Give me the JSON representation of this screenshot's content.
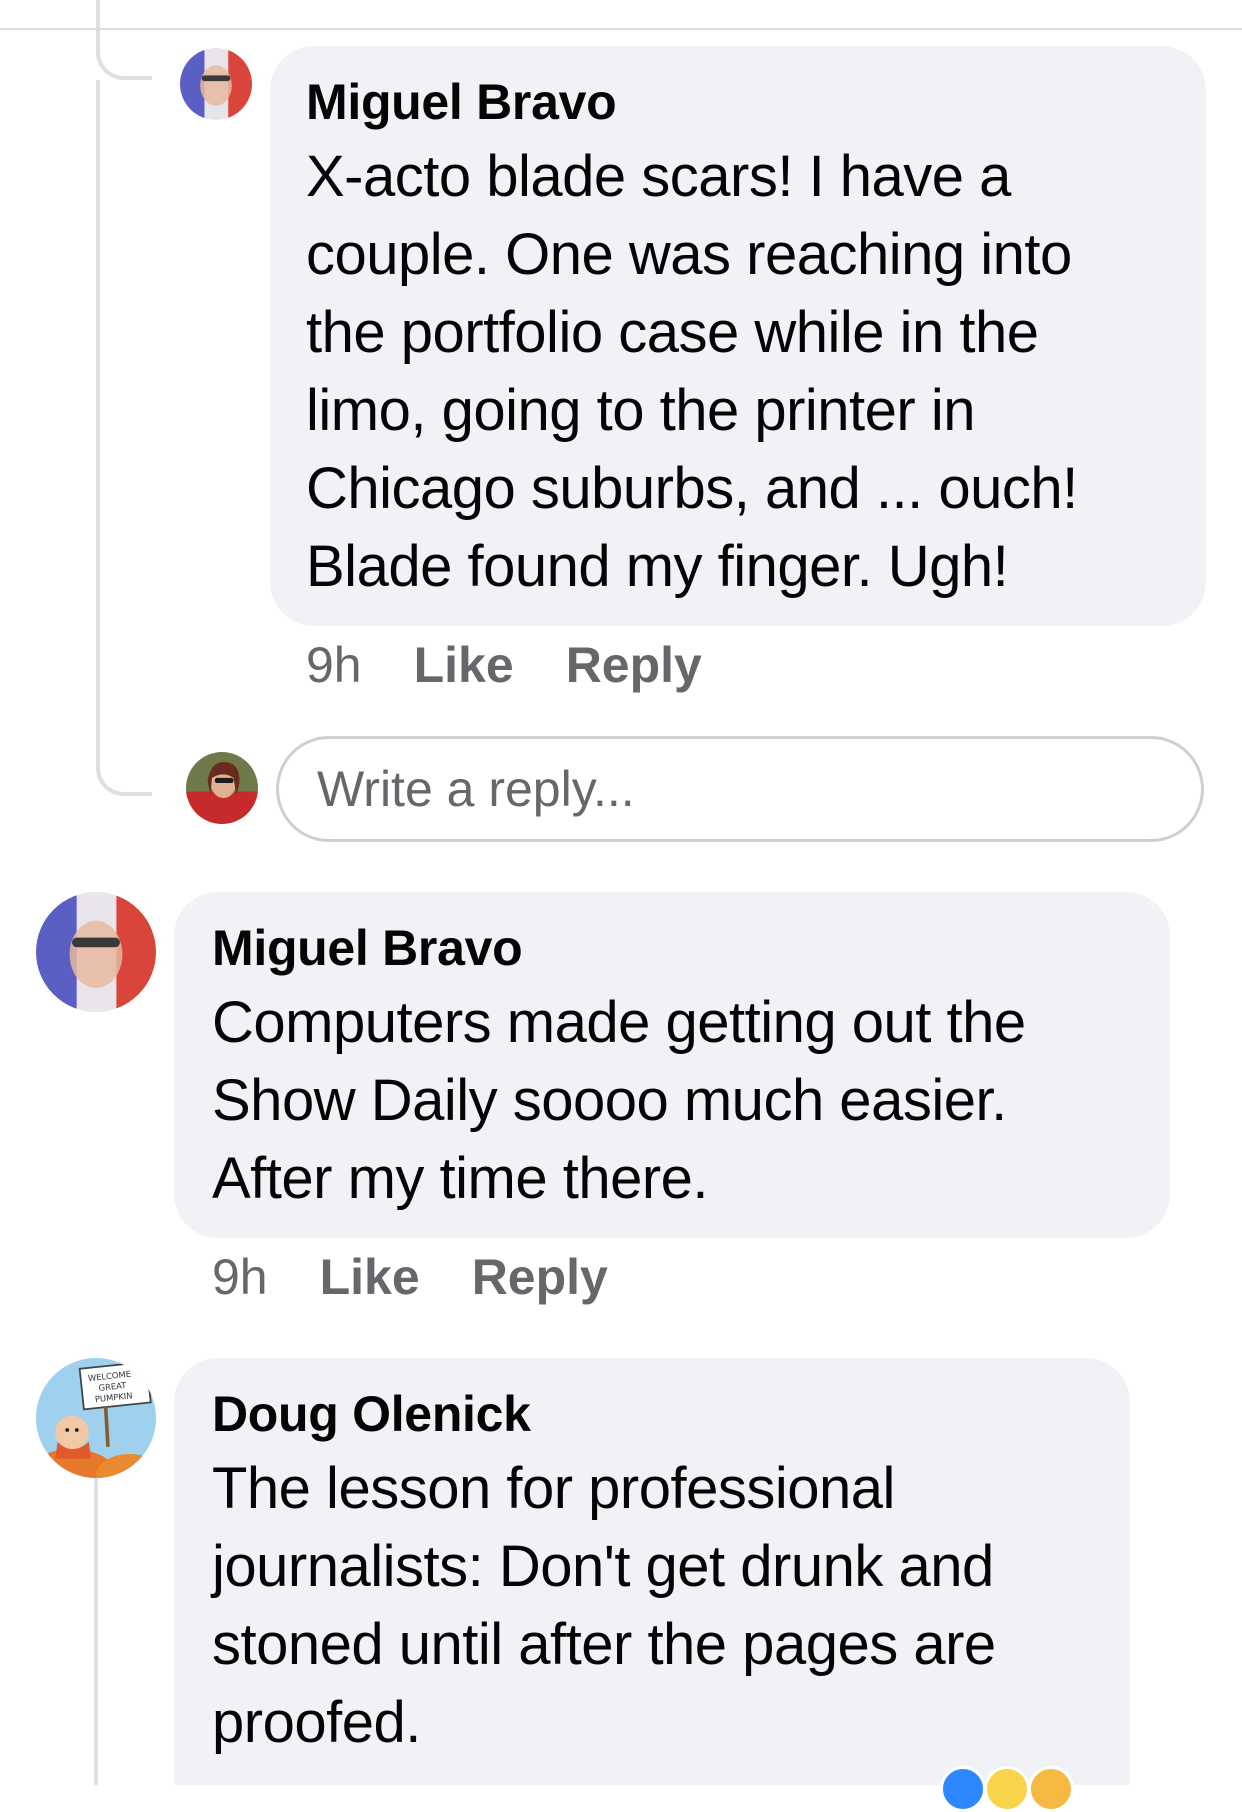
{
  "comments": [
    {
      "author": "Miguel Bravo",
      "text_lines": [
        "X-acto blade scars! I have a",
        "couple. One was reaching into",
        "the portfolio case while in the",
        "limo, going to the printer in",
        "Chicago suburbs, and ... ouch!",
        "Blade found my finger. Ugh!"
      ],
      "time": "9h",
      "like_label": "Like",
      "reply_label": "Reply"
    },
    {
      "author": "Miguel Bravo",
      "text_lines": [
        "Computers made getting out the",
        "Show Daily soooo much easier.",
        "After my time there."
      ],
      "time": "9h",
      "like_label": "Like",
      "reply_label": "Reply"
    },
    {
      "author": "Doug Olenick",
      "text_lines": [
        "The lesson for professional",
        "journalists: Don't get drunk and",
        "stoned until after the pages are",
        "proofed."
      ]
    }
  ],
  "reply_box": {
    "placeholder": "Write a reply..."
  },
  "avatars": {
    "doug_sign": [
      "WELCOME",
      "GREAT",
      "PUMPKIN"
    ]
  },
  "colors": {
    "bubble": "#f0f2f5",
    "meta_text": "#65676b",
    "thread_line": "#dcdfe4"
  }
}
